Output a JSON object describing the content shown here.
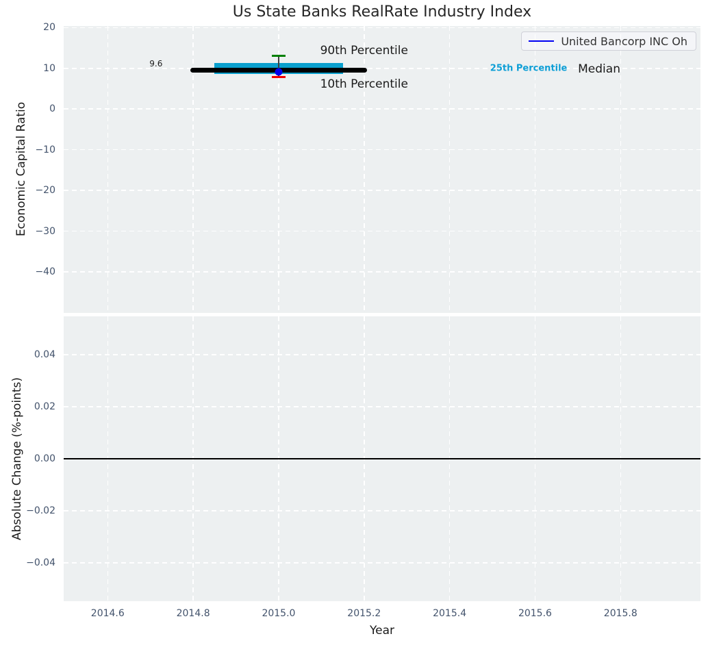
{
  "figure": {
    "title": "Us State Banks RealRate Industry Index"
  },
  "legend": {
    "label": "United Bancorp INC Oh"
  },
  "colors": {
    "figure_bg": "#ffffff",
    "axes_bg": "#edf0f1",
    "grid": "#ffffff",
    "tick_label": "#42526b",
    "text": "#1a1a1a",
    "title_text": "#262626",
    "band": "#0aa0ce",
    "median_line": "#000000",
    "p90_cap": "#008000",
    "p10_cap": "#f20000",
    "whisker_line": "#3f3f3f",
    "point": "#0000ee",
    "legend_line": "#0000f2",
    "zero_line": "#000000",
    "annotation_25th": "#0f9fd6"
  },
  "chart_data": [
    {
      "type": "line",
      "subtype": "percentile-band-timeseries",
      "title": "Us State Banks RealRate Industry Index",
      "ylabel": "Economic Capital Ratio",
      "xlim": [
        2014.497,
        2015.987
      ],
      "ylim": [
        -50.1,
        20.4
      ],
      "grid": true,
      "legend_position": "upper right",
      "xticks": [
        {
          "v": 2014.6,
          "label": "2014.6"
        },
        {
          "v": 2014.8,
          "label": "2014.8"
        },
        {
          "v": 2015.0,
          "label": "2015.0"
        },
        {
          "v": 2015.2,
          "label": "2015.2"
        },
        {
          "v": 2015.4,
          "label": "2015.4"
        },
        {
          "v": 2015.6,
          "label": "2015.6"
        },
        {
          "v": 2015.8,
          "label": "2015.8"
        }
      ],
      "yticks": [
        {
          "v": 20,
          "label": "20"
        },
        {
          "v": 10,
          "label": "10"
        },
        {
          "v": 0,
          "label": "0"
        },
        {
          "v": -10,
          "label": "−10"
        },
        {
          "v": -20,
          "label": "−20"
        },
        {
          "v": -30,
          "label": "−30"
        },
        {
          "v": -40,
          "label": "−40"
        }
      ],
      "series": [
        {
          "name": "United Bancorp INC Oh",
          "x": [
            2015.0
          ],
          "y": [
            9.2
          ]
        }
      ],
      "median": {
        "value": 9.6,
        "x0": 2014.8,
        "x1": 2015.2
      },
      "iqr_band": {
        "low": 8.7,
        "high": 11.3,
        "x0": 2014.85,
        "x1": 2015.15
      },
      "whiskers": {
        "x": 2015.0,
        "p10": 7.9,
        "p90": 13.0
      },
      "annotations": [
        {
          "text": "9.6",
          "x": 2014.713,
          "y": 11.2,
          "size": 12,
          "color": "#1a1a1a",
          "weight": "normal"
        },
        {
          "text": "90th Percentile",
          "x": 2015.2,
          "y": 14.3,
          "size": 17,
          "color": "#1a1a1a",
          "weight": "normal"
        },
        {
          "text": "10th Percentile",
          "x": 2015.2,
          "y": 6.1,
          "size": 17,
          "color": "#1a1a1a",
          "weight": "normal"
        },
        {
          "text": "25th Percentile",
          "x": 2015.585,
          "y": 10.0,
          "size": 13,
          "color": "#0f9fd6",
          "weight": "bold"
        },
        {
          "text": "Median",
          "x": 2015.75,
          "y": 9.8,
          "size": 17,
          "color": "#1a1a1a",
          "weight": "normal"
        }
      ]
    },
    {
      "type": "line",
      "subtype": "absolute-change",
      "ylabel": "Absolute Change (%-points)",
      "xlabel": "Year",
      "xlim": [
        2014.497,
        2015.987
      ],
      "ylim": [
        -0.0547,
        0.0547
      ],
      "grid": true,
      "zero_line": 0.0,
      "xticks": [
        {
          "v": 2014.6,
          "label": "2014.6"
        },
        {
          "v": 2014.8,
          "label": "2014.8"
        },
        {
          "v": 2015.0,
          "label": "2015.0"
        },
        {
          "v": 2015.2,
          "label": "2015.2"
        },
        {
          "v": 2015.4,
          "label": "2015.4"
        },
        {
          "v": 2015.6,
          "label": "2015.6"
        },
        {
          "v": 2015.8,
          "label": "2015.8"
        }
      ],
      "yticks": [
        {
          "v": 0.04,
          "label": "0.04"
        },
        {
          "v": 0.02,
          "label": "0.02"
        },
        {
          "v": 0.0,
          "label": "0.00"
        },
        {
          "v": -0.02,
          "label": "−0.02"
        },
        {
          "v": -0.04,
          "label": "−0.04"
        }
      ],
      "series": []
    }
  ]
}
